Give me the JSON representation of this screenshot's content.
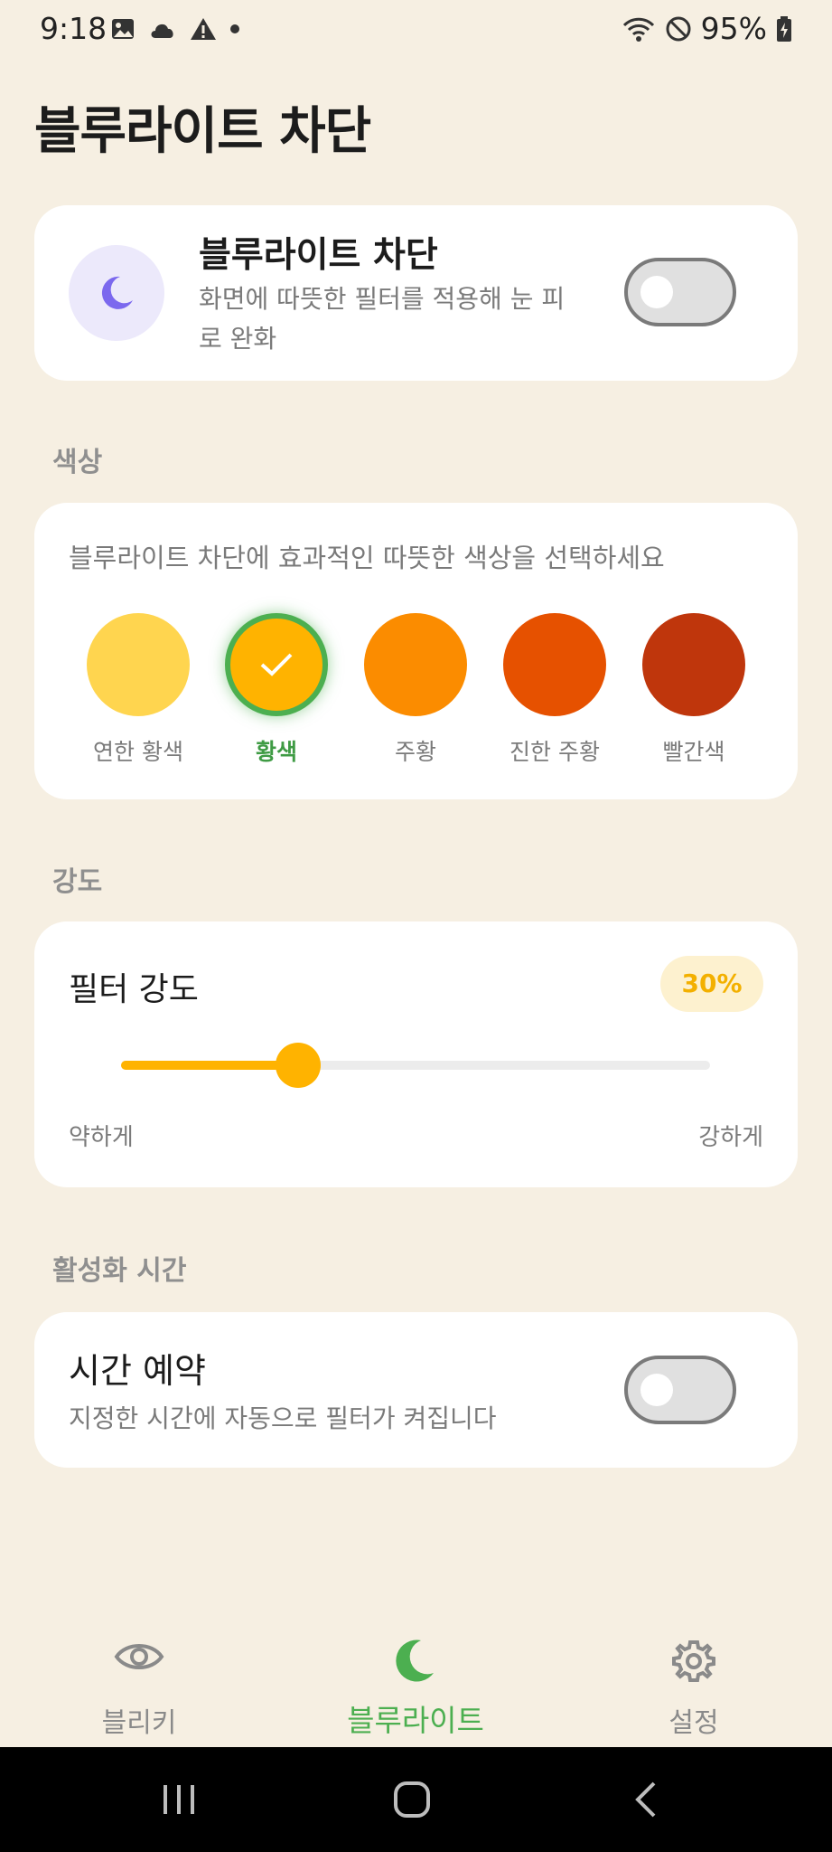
{
  "status_bar": {
    "time": "9:18",
    "battery": "95%"
  },
  "page_title": "블루라이트 차단",
  "main_toggle": {
    "title": "블루라이트 차단",
    "description": "화면에 따뜻한 필터를 적용해 눈 피로 완화",
    "enabled": false,
    "icon": "moon-icon"
  },
  "color_section": {
    "label": "색상",
    "description": "블루라이트 차단에 효과적인 따뜻한 색상을 선택하세요",
    "options": [
      {
        "label": "연한 황색",
        "color": "#ffd54f",
        "selected": false
      },
      {
        "label": "황색",
        "color": "#ffb300",
        "selected": true
      },
      {
        "label": "주황",
        "color": "#fb8c00",
        "selected": false
      },
      {
        "label": "진한 주황",
        "color": "#e65100",
        "selected": false
      },
      {
        "label": "빨간색",
        "color": "#bf360c",
        "selected": false
      }
    ]
  },
  "intensity_section": {
    "label": "강도",
    "title": "필터 강도",
    "value_label": "30%",
    "value": 0.3,
    "min_label": "약하게",
    "max_label": "강하게"
  },
  "schedule_section": {
    "label": "활성화 시간",
    "title": "시간 예약",
    "description": "지정한 시간에 자동으로 필터가 켜집니다",
    "enabled": false
  },
  "bottom_nav": {
    "items": [
      {
        "label": "블리키",
        "icon": "eye-icon",
        "active": false
      },
      {
        "label": "블루라이트",
        "icon": "moon-icon",
        "active": true
      },
      {
        "label": "설정",
        "icon": "gear-icon",
        "active": false
      }
    ]
  },
  "colors": {
    "background": "#f6efe2",
    "accent_green": "#4caf50",
    "accent_amber": "#ffb300",
    "moon_purple": "#7b68ee"
  }
}
